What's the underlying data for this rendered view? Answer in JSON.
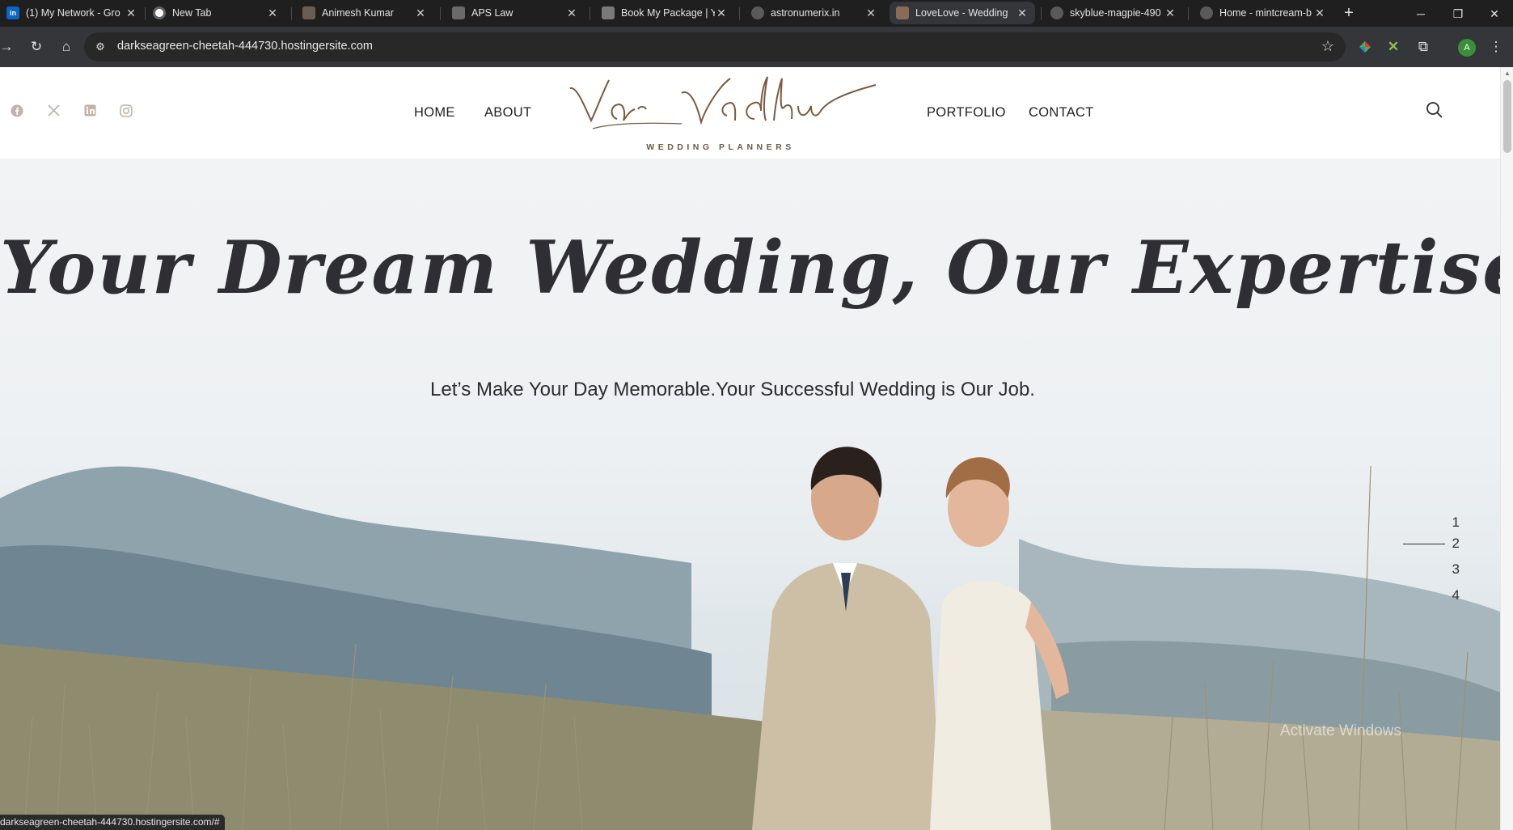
{
  "browser": {
    "tabs": [
      {
        "title": "(1) My Network - Gro",
        "favicon": "linkedin-icon",
        "favicon_color": "#0a66c2",
        "favicon_text": "in",
        "active": false
      },
      {
        "title": "New Tab",
        "favicon": "chrome-icon",
        "favicon_color": "#5f6368",
        "favicon_text": "",
        "active": false
      },
      {
        "title": "Animesh Kumar",
        "favicon": "profile-icon",
        "favicon_color": "#6b5d52",
        "favicon_text": "",
        "active": false
      },
      {
        "title": "APS Law",
        "favicon": "law-icon",
        "favicon_color": "#6a6a6a",
        "favicon_text": "",
        "active": false
      },
      {
        "title": "Book My Package | Yo",
        "favicon": "package-icon",
        "favicon_color": "#7a7a7a",
        "favicon_text": "",
        "active": false
      },
      {
        "title": "astronumerix.in",
        "favicon": "globe-icon",
        "favicon_color": "#5a5a5a",
        "favicon_text": "",
        "active": false
      },
      {
        "title": "LoveLove - Wedding",
        "favicon": "wedding-icon",
        "favicon_color": "#8a6a5a",
        "favicon_text": "",
        "active": true
      },
      {
        "title": "skyblue-magpie-490",
        "favicon": "globe-icon",
        "favicon_color": "#5a5a5a",
        "favicon_text": "",
        "active": false
      },
      {
        "title": "Home - mintcream-b",
        "favicon": "globe-icon",
        "favicon_color": "#5a5a5a",
        "favicon_text": "",
        "active": false
      }
    ],
    "url": "darkseagreen-cheetah-444730.hostingersite.com",
    "profile_initial": "A",
    "status_url": "darkseagreen-cheetah-444730.hostingersite.com/#"
  },
  "site": {
    "nav": {
      "home": "HOME",
      "about": "ABOUT",
      "portfolio": "PORTFOLIO",
      "contact": "CONTACT"
    },
    "logo": {
      "name": "Var Vadhu",
      "tagline": "WEDDING PLANNERS"
    },
    "social": [
      "facebook-icon",
      "x-icon",
      "linkedin-icon",
      "instagram-icon"
    ],
    "accent_color": "#8b6b4e"
  },
  "hero": {
    "title": "Your Dream Wedding, Our Expertise.",
    "subtitle": "Let’s Make Your Day Memorable.Your Successful Wedding is Our Job.",
    "slides": [
      "1",
      "2",
      "3",
      "4"
    ],
    "active_slide": "2"
  },
  "watermark": "Activate Windows"
}
